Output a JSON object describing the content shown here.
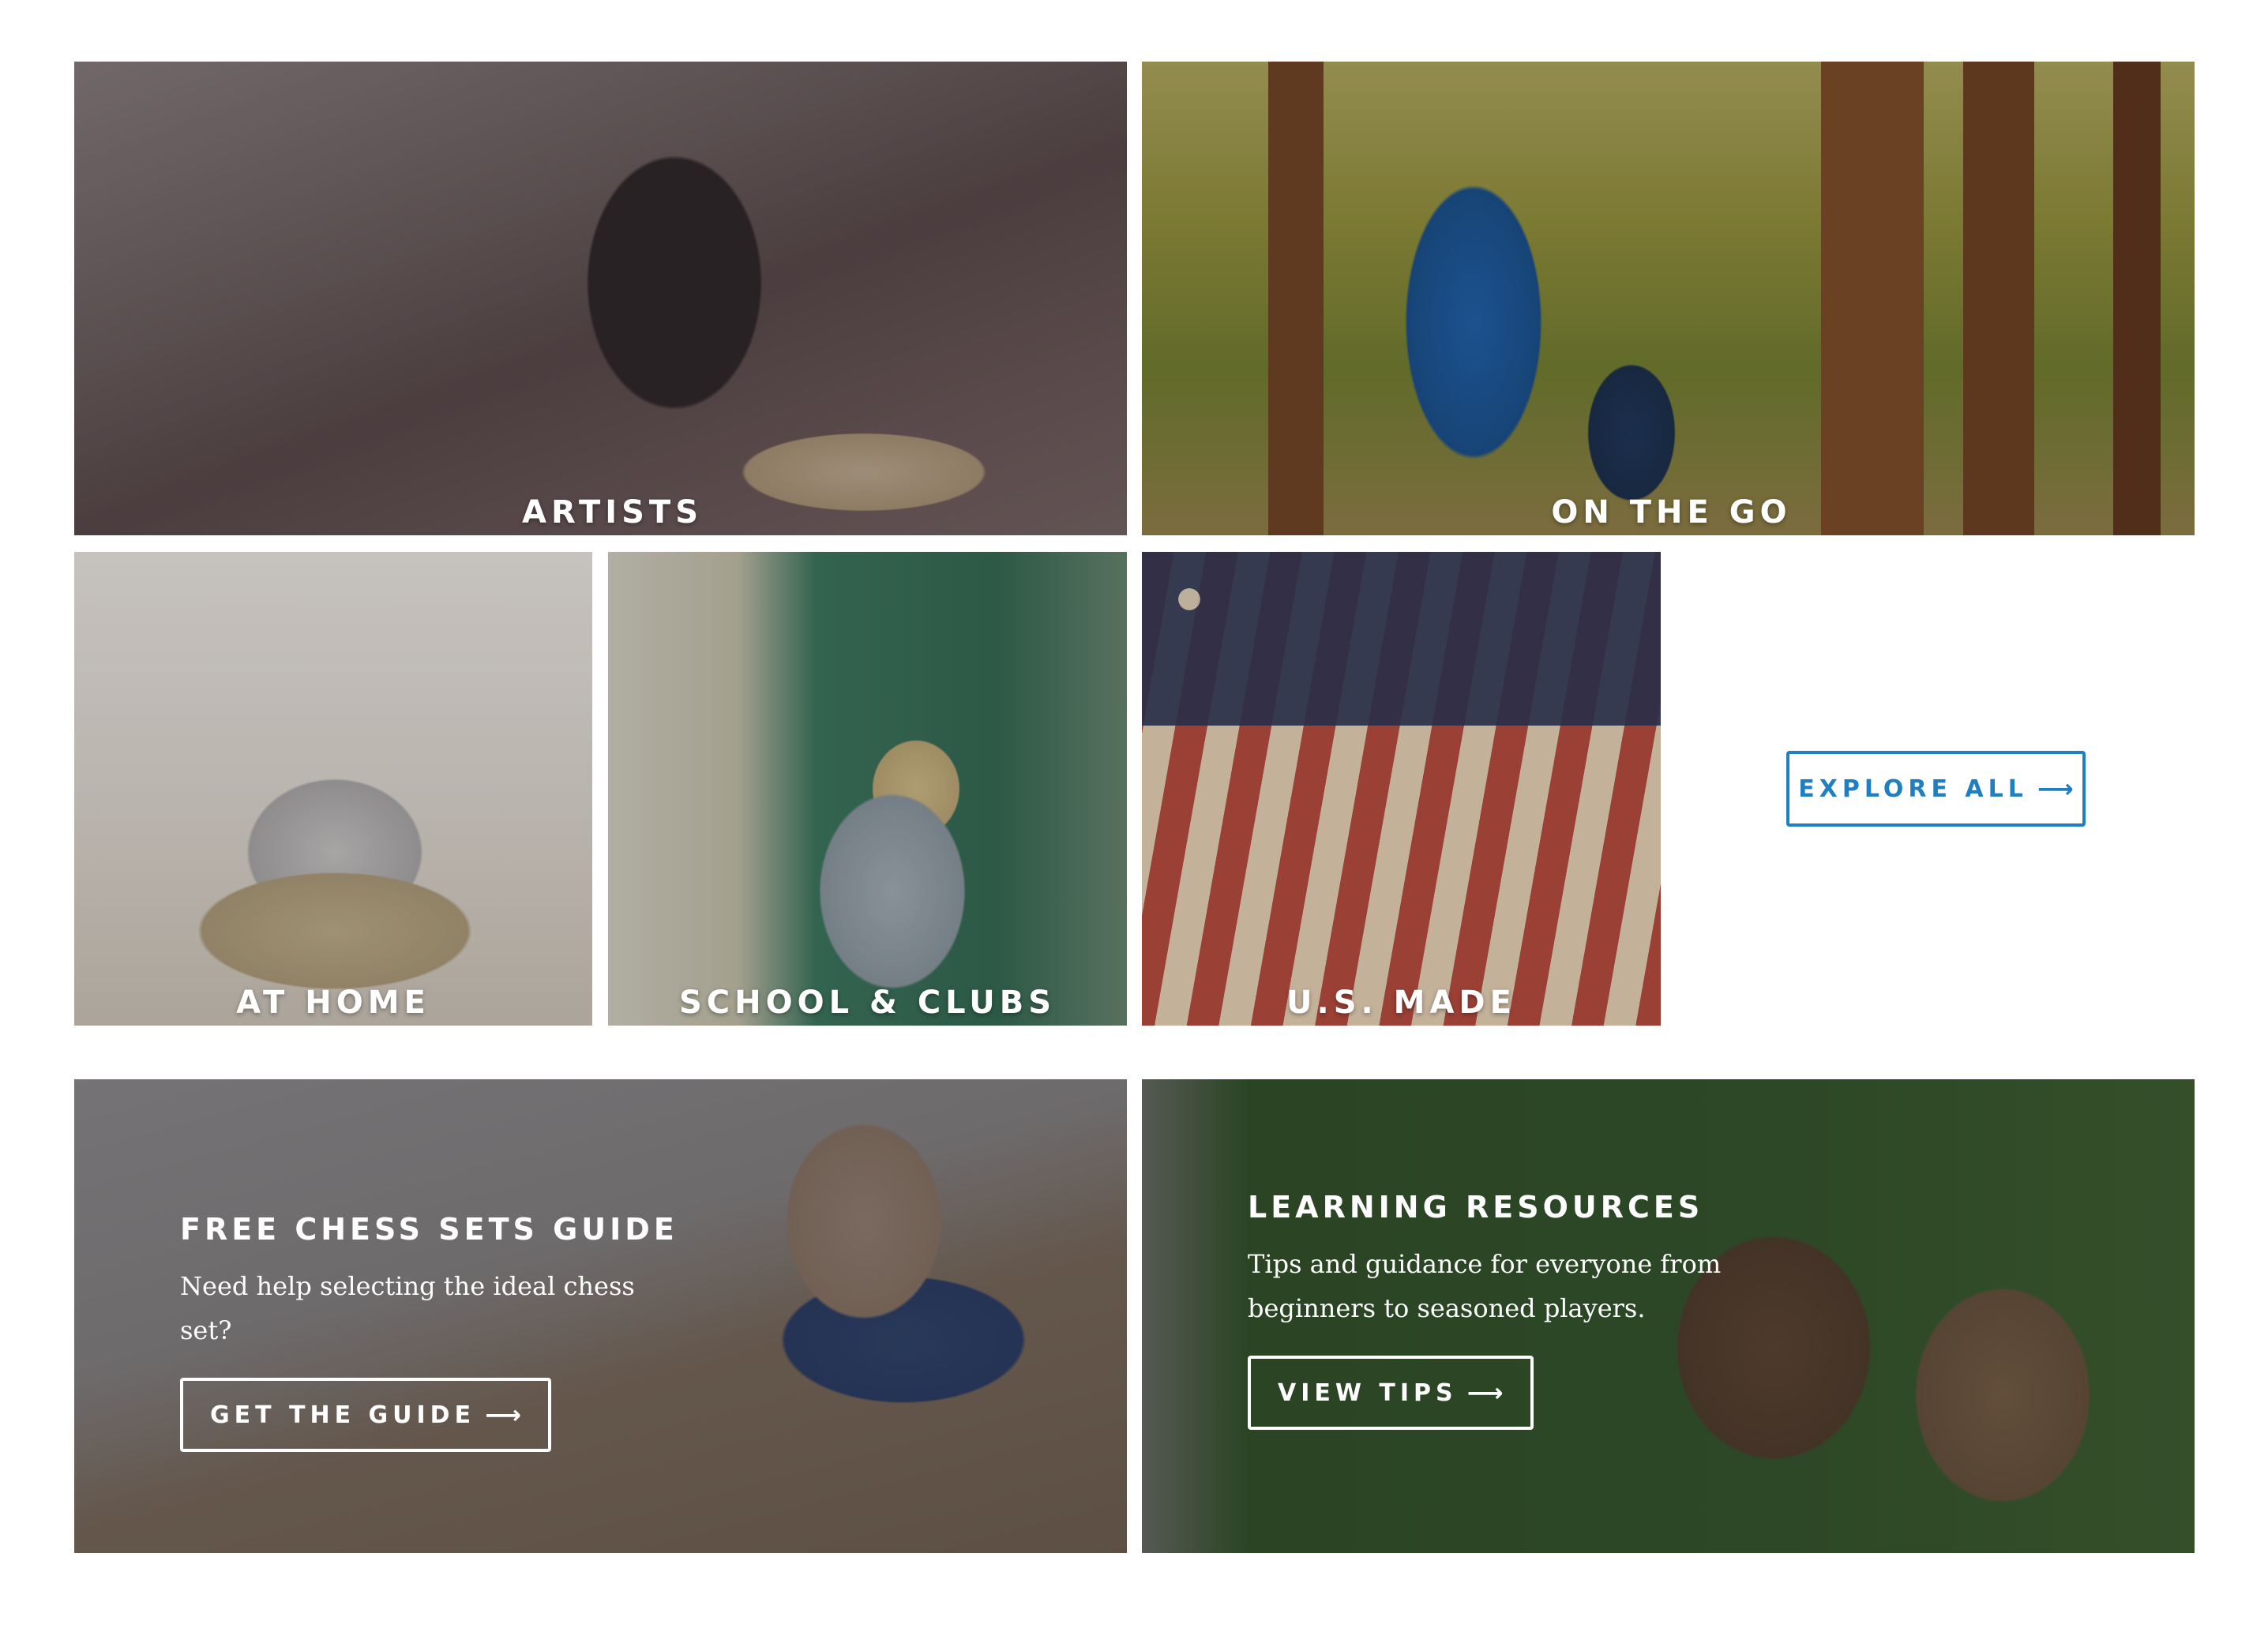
{
  "categories": {
    "artists": "ARTISTS",
    "on_the_go": "ON THE GO",
    "at_home": "AT HOME",
    "school_clubs": "SCHOOL & CLUBS",
    "us_made": "U.S. MADE"
  },
  "explore": {
    "label": "EXPLORE ALL",
    "arrow": "⟶"
  },
  "promos": {
    "guide": {
      "title": "FREE CHESS SETS GUIDE",
      "description": "Need help selecting the ideal chess set?",
      "button": "GET THE GUIDE",
      "arrow": "⟶"
    },
    "learning": {
      "title": "LEARNING RESOURCES",
      "description": "Tips and guidance for everyone from beginners to seasoned players.",
      "button": "VIEW TIPS",
      "arrow": "⟶"
    }
  },
  "colors": {
    "accent": "#1f7fc0",
    "overlay_text": "#ffffff"
  }
}
